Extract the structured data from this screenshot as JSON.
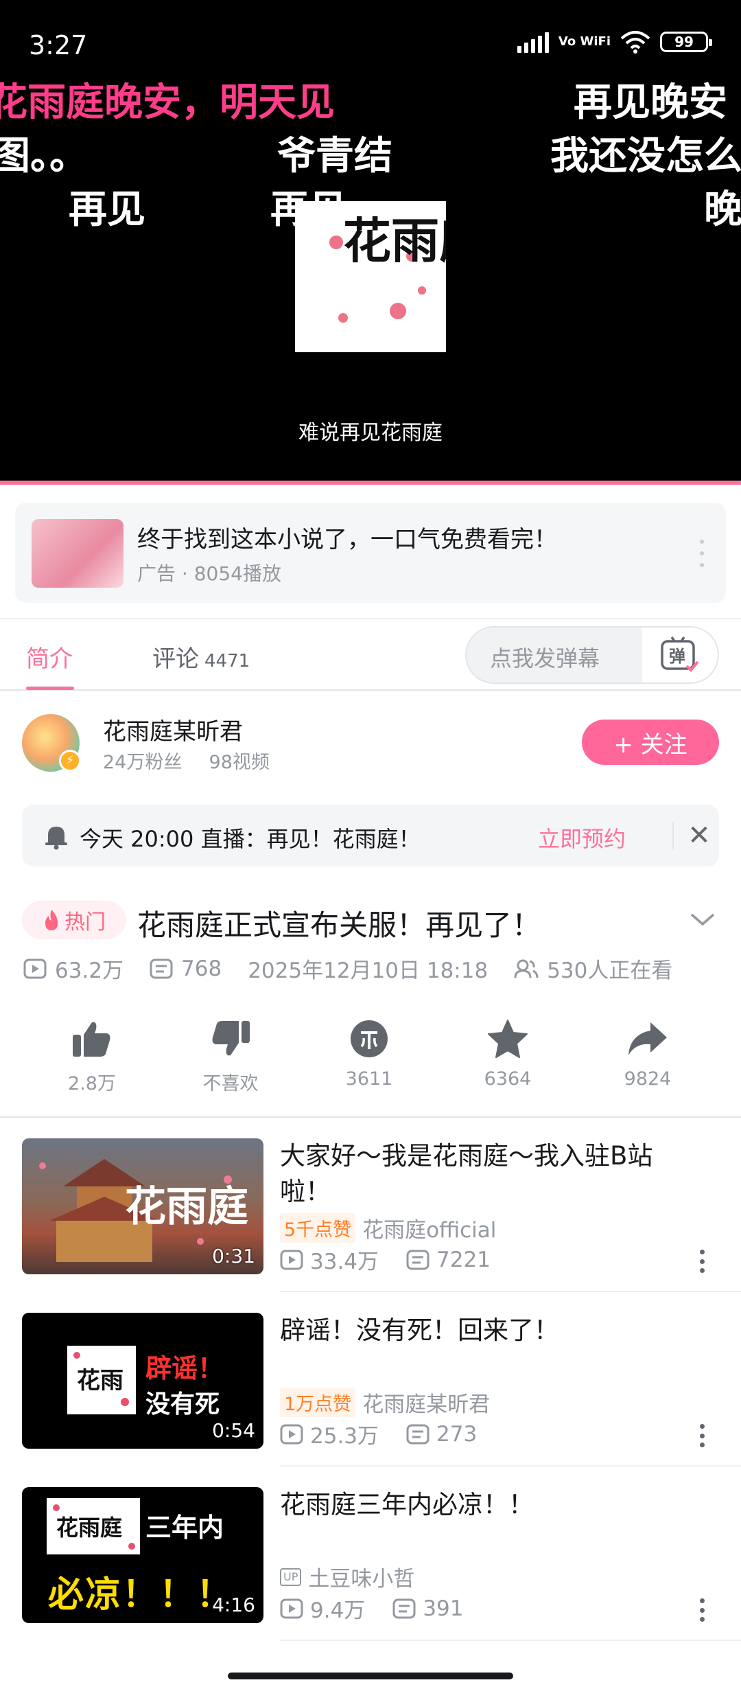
{
  "status_bar": {
    "time": "3:27",
    "network": "Vo WiFi",
    "battery": "99"
  },
  "player": {
    "danmaku": [
      {
        "text": "花雨庭晚安，明天见",
        "pink": true
      },
      {
        "text": "再见晚安",
        "pink": false
      },
      {
        "text": "图。。",
        "pink": false
      },
      {
        "text": "爷青结",
        "pink": false
      },
      {
        "text": "我还没怎么",
        "pink": false
      },
      {
        "text": "再见",
        "pink": false
      },
      {
        "text": "再见",
        "pink": false
      },
      {
        "text": "晚",
        "pink": false
      }
    ],
    "logo_text": "花雨庭",
    "video_title": "难说再见花雨庭",
    "progress": 0.995
  },
  "ad": {
    "title": "终于找到这本小说了，一口气免费看完！",
    "sub": "广告 · 8054播放"
  },
  "tabs": [
    {
      "label": "简介",
      "count": ""
    },
    {
      "label": "评论",
      "count": "4471"
    }
  ],
  "danmu_input": {
    "placeholder": "点我发弹幕",
    "button": "弹"
  },
  "uploader": {
    "name": "花雨庭某昕君",
    "fans": "24万粉丝",
    "videos": "98视频",
    "follow_label": "+ 关注"
  },
  "reminder": {
    "text": "今天 20:00 直播：再见！花雨庭！",
    "action": "立即预约"
  },
  "video": {
    "hot_label": "热门",
    "title": "花雨庭正式宣布关服！再见了！",
    "plays": "63.2万",
    "danmaku_count": "768",
    "date": "2025年12月10日 18:18",
    "watching": "530人正在看"
  },
  "actions": [
    {
      "name": "like",
      "label": "2.8万"
    },
    {
      "name": "dislike",
      "label": "不喜欢"
    },
    {
      "name": "coin",
      "label": "3611"
    },
    {
      "name": "favorite",
      "label": "6364"
    },
    {
      "name": "share",
      "label": "9824"
    }
  ],
  "related": [
    {
      "title": "大家好～我是花雨庭～我入驻B站啦！",
      "likes": "5千点赞",
      "author": "花雨庭official",
      "author_up": false,
      "plays": "33.4万",
      "comments": "7221",
      "duration": "0:31",
      "thumb_caption": "花雨庭"
    },
    {
      "title": "辟谣！没有死！回来了！",
      "likes": "1万点赞",
      "author": "花雨庭某昕君",
      "author_up": false,
      "plays": "25.3万",
      "comments": "273",
      "duration": "0:54",
      "thumb_caption": "辟谣！没有死"
    },
    {
      "title": "花雨庭三年内必凉！！",
      "likes": "",
      "author": "土豆味小哲",
      "author_up": true,
      "plays": "9.4万",
      "comments": "391",
      "duration": "4:16",
      "thumb_caption": "三年内必凉！！！"
    }
  ],
  "colors": {
    "accent": "#fb7299",
    "follow": "#ff6699",
    "danmaku_pink": "#ff3d8a"
  }
}
